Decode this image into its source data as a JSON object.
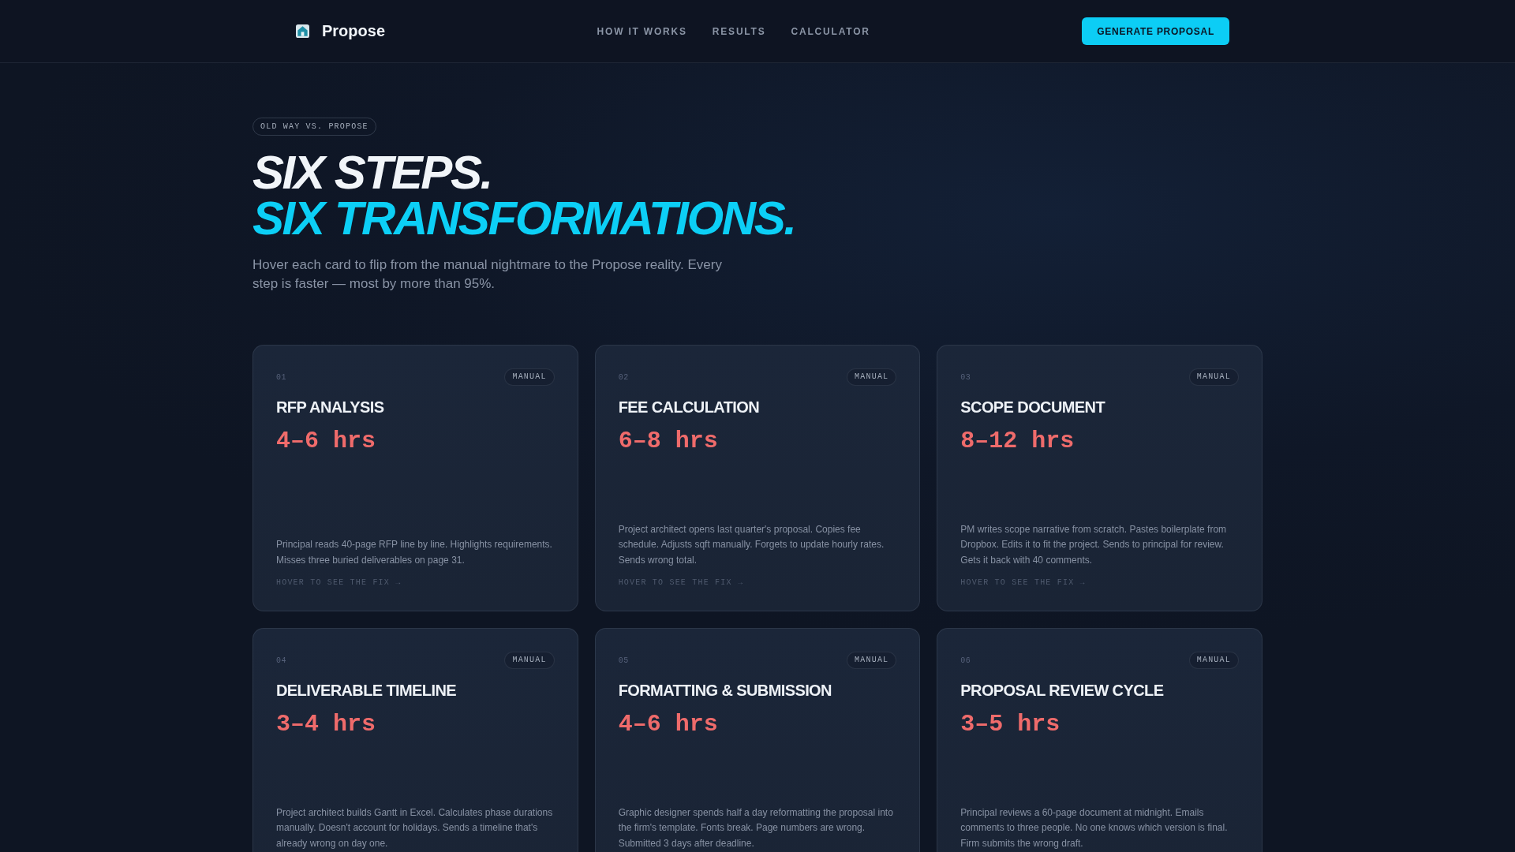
{
  "header": {
    "brand": "Propose",
    "nav": [
      "HOW IT WORKS",
      "RESULTS",
      "CALCULATOR"
    ],
    "cta": "GENERATE PROPOSAL"
  },
  "hero": {
    "badge": "OLD WAY VS. PROPOSE",
    "title_line_1": "SIX STEPS.",
    "title_line_2": "SIX TRANSFORMATIONS.",
    "intro": "Hover each card to flip from the manual nightmare to the Propose reality. Every step is faster — most by more than 95%."
  },
  "cards": [
    {
      "number": "01",
      "tag": "MANUAL",
      "title": "RFP ANALYSIS",
      "time": "4–6 hrs",
      "description": "Principal reads 40-page RFP line by line. Highlights requirements. Misses three buried deliverables on page 31.",
      "hint": "HOVER TO SEE THE FIX →"
    },
    {
      "number": "02",
      "tag": "MANUAL",
      "title": "FEE CALCULATION",
      "time": "6–8 hrs",
      "description": "Project architect opens last quarter's proposal. Copies fee schedule. Adjusts sqft manually. Forgets to update hourly rates. Sends wrong total.",
      "hint": "HOVER TO SEE THE FIX →"
    },
    {
      "number": "03",
      "tag": "MANUAL",
      "title": "SCOPE DOCUMENT",
      "time": "8–12 hrs",
      "description": "PM writes scope narrative from scratch. Pastes boilerplate from Dropbox. Edits it to fit the project. Sends to principal for review. Gets it back with 40 comments.",
      "hint": "HOVER TO SEE THE FIX →"
    },
    {
      "number": "04",
      "tag": "MANUAL",
      "title": "DELIVERABLE TIMELINE",
      "time": "3–4 hrs",
      "description": "Project architect builds Gantt in Excel. Calculates phase durations manually. Doesn't account for holidays. Sends a timeline that's already wrong on day one."
    },
    {
      "number": "05",
      "tag": "MANUAL",
      "title": "FORMATTING & SUBMISSION",
      "time": "4–6 hrs",
      "description": "Graphic designer spends half a day reformatting the proposal into the firm's template. Fonts break. Page numbers are wrong. Submitted 3 days after deadline."
    },
    {
      "number": "06",
      "tag": "MANUAL",
      "title": "PROPOSAL REVIEW CYCLE",
      "time": "3–5 hrs",
      "description": "Principal reviews a 60-page document at midnight. Emails comments to three people. No one knows which version is final. Firm submits the wrong draft."
    }
  ]
}
